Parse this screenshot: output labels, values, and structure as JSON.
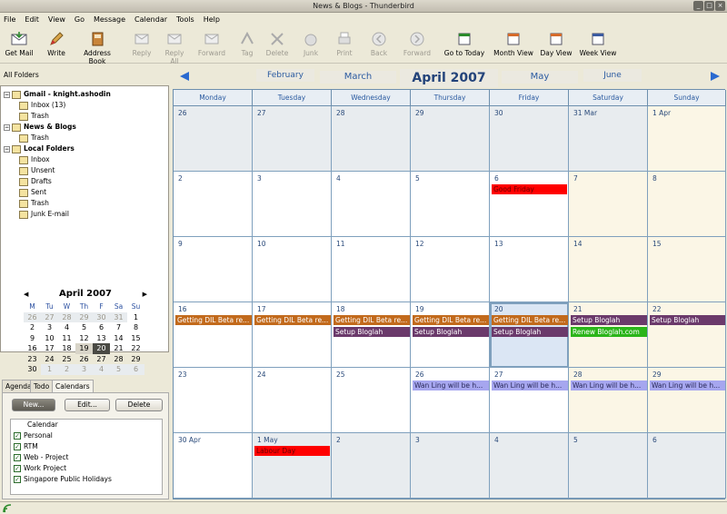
{
  "window": {
    "title": "News & Blogs - Thunderbird"
  },
  "menu": [
    "File",
    "Edit",
    "View",
    "Go",
    "Message",
    "Calendar",
    "Tools",
    "Help"
  ],
  "toolbar": {
    "buttons": [
      {
        "label": "Get Mail",
        "enabled": true
      },
      {
        "label": "Write",
        "enabled": true
      },
      {
        "label": "Address Book",
        "enabled": true
      },
      {
        "label": "Reply",
        "enabled": false
      },
      {
        "label": "Reply All",
        "enabled": false
      },
      {
        "label": "Forward",
        "enabled": false
      },
      {
        "label": "Tag",
        "enabled": false
      },
      {
        "label": "Delete",
        "enabled": false
      },
      {
        "label": "Junk",
        "enabled": false
      },
      {
        "label": "Print",
        "enabled": false
      },
      {
        "label": "Back",
        "enabled": false
      },
      {
        "label": "Forward",
        "enabled": false
      },
      {
        "label": "Go to Today",
        "enabled": true
      },
      {
        "label": "Month View",
        "enabled": true
      },
      {
        "label": "Day View",
        "enabled": true
      },
      {
        "label": "Week View",
        "enabled": true
      }
    ]
  },
  "folders": {
    "header": "All Folders",
    "items": [
      {
        "label": "Gmail - knight.ashodin",
        "level": 0,
        "bold": true
      },
      {
        "label": "Inbox (13)",
        "level": 1
      },
      {
        "label": "Trash",
        "level": 1
      },
      {
        "label": "News & Blogs",
        "level": 0,
        "bold": true
      },
      {
        "label": "Trash",
        "level": 1
      },
      {
        "label": "Local Folders",
        "level": 0,
        "bold": true
      },
      {
        "label": "Inbox",
        "level": 1
      },
      {
        "label": "Unsent",
        "level": 1
      },
      {
        "label": "Drafts",
        "level": 1
      },
      {
        "label": "Sent",
        "level": 1
      },
      {
        "label": "Trash",
        "level": 1
      },
      {
        "label": "Junk E-mail",
        "level": 1
      }
    ]
  },
  "minical": {
    "title": "April 2007",
    "days": [
      "M",
      "Tu",
      "W",
      "Th",
      "F",
      "Sa",
      "Su"
    ],
    "weeks": [
      [
        "26",
        "27",
        "28",
        "29",
        "30",
        "31",
        "1"
      ],
      [
        "2",
        "3",
        "4",
        "5",
        "6",
        "7",
        "8"
      ],
      [
        "9",
        "10",
        "11",
        "12",
        "13",
        "14",
        "15"
      ],
      [
        "16",
        "17",
        "18",
        "19",
        "20",
        "21",
        "22"
      ],
      [
        "23",
        "24",
        "25",
        "26",
        "27",
        "28",
        "29"
      ],
      [
        "30",
        "1",
        "2",
        "3",
        "4",
        "5",
        "6"
      ]
    ]
  },
  "tabs": [
    "Agenda",
    "Todo",
    "Calendars"
  ],
  "calendars": {
    "new": "New...",
    "edit": "Edit...",
    "delete": "Delete",
    "header": "Calendar",
    "items": [
      "Personal",
      "RTM",
      "Web - Project",
      "Work Project",
      "Singapore Public Holidays"
    ]
  },
  "nav": {
    "prev2": "February",
    "prev1": "March",
    "current": "April 2007",
    "next1": "May",
    "next2": "June"
  },
  "weekdays": [
    "Monday",
    "Tuesday",
    "Wednesday",
    "Thursday",
    "Friday",
    "Saturday",
    "Sunday"
  ],
  "weeks": [
    {
      "days": [
        "26",
        "27",
        "28",
        "29",
        "30",
        "31 Mar",
        "1 Apr"
      ]
    },
    {
      "days": [
        "2",
        "3",
        "4",
        "5",
        "6",
        "7",
        "8"
      ]
    },
    {
      "days": [
        "9",
        "10",
        "11",
        "12",
        "13",
        "14",
        "15"
      ]
    },
    {
      "days": [
        "16",
        "17",
        "18",
        "19",
        "20",
        "21",
        "22"
      ]
    },
    {
      "days": [
        "23",
        "24",
        "25",
        "26",
        "27",
        "28",
        "29"
      ]
    },
    {
      "days": [
        "30 Apr",
        "1 May",
        "2",
        "3",
        "4",
        "5",
        "6"
      ]
    }
  ],
  "events": [
    {
      "week": 1,
      "day": 4,
      "row": 0,
      "label": "Good Friday",
      "color": "red"
    },
    {
      "week": 3,
      "day": 0,
      "row": 0,
      "label": "Getting DIL Beta re...",
      "color": "org"
    },
    {
      "week": 3,
      "day": 1,
      "row": 0,
      "label": "Getting DIL Beta re...",
      "color": "org"
    },
    {
      "week": 3,
      "day": 2,
      "row": 0,
      "label": "Getting DIL Beta re...",
      "color": "org"
    },
    {
      "week": 3,
      "day": 3,
      "row": 0,
      "label": "Getting DIL Beta re...",
      "color": "org"
    },
    {
      "week": 3,
      "day": 4,
      "row": 0,
      "label": "Getting DIL Beta re...",
      "color": "org"
    },
    {
      "week": 3,
      "day": 5,
      "row": 0,
      "label": "Setup Bloglah",
      "color": "pur"
    },
    {
      "week": 3,
      "day": 6,
      "row": 0,
      "label": "Setup Bloglah",
      "color": "pur"
    },
    {
      "week": 3,
      "day": 2,
      "row": 1,
      "label": "Setup Bloglah",
      "color": "pur"
    },
    {
      "week": 3,
      "day": 3,
      "row": 1,
      "label": "Setup Bloglah",
      "color": "pur"
    },
    {
      "week": 3,
      "day": 4,
      "row": 1,
      "label": "Setup Bloglah",
      "color": "pur"
    },
    {
      "week": 3,
      "day": 5,
      "row": 1,
      "label": "Renew Bloglah.com",
      "color": "grn"
    },
    {
      "week": 4,
      "day": 3,
      "row": 0,
      "label": "Wan Ling will be h...",
      "color": "lav"
    },
    {
      "week": 4,
      "day": 4,
      "row": 0,
      "label": "Wan Ling will be h...",
      "color": "lav"
    },
    {
      "week": 4,
      "day": 5,
      "row": 0,
      "label": "Wan Ling will be h...",
      "color": "lav"
    },
    {
      "week": 4,
      "day": 6,
      "row": 0,
      "label": "Wan Ling will be h...",
      "color": "lav"
    },
    {
      "week": 5,
      "day": 1,
      "row": 0,
      "label": "Labour Day",
      "color": "red"
    }
  ]
}
